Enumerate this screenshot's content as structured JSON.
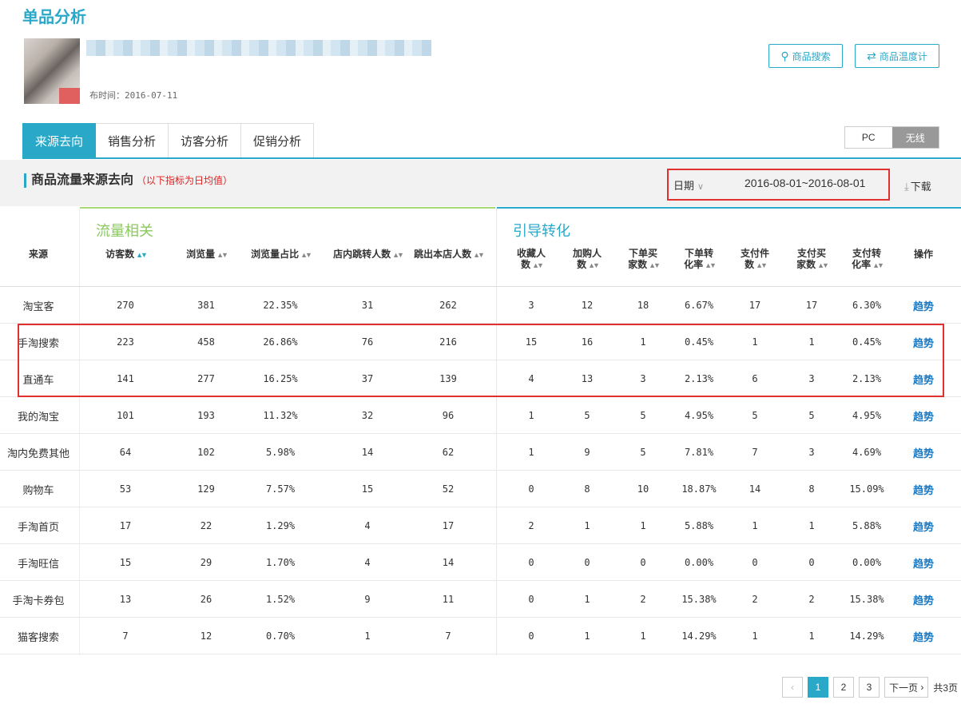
{
  "page": {
    "title": "单品分析"
  },
  "product": {
    "publish_time": "布时间：2016-07-11"
  },
  "buttons": {
    "search": "商品搜索",
    "compare": "商品温度计"
  },
  "tabs": [
    "来源去向",
    "销售分析",
    "访客分析",
    "促销分析"
  ],
  "device": {
    "pc": "PC",
    "wireless": "无线"
  },
  "section": {
    "title": "商品流量来源去向",
    "note": "（以下指标为日均值）"
  },
  "date": {
    "label": "日期",
    "range": "2016-08-01~2016-08-01"
  },
  "download": "下载",
  "groups": {
    "traffic": "流量相关",
    "conversion": "引导转化"
  },
  "columns": [
    {
      "label": "来源",
      "sortable": false
    },
    {
      "label": "访客数",
      "sortable": true,
      "active": true
    },
    {
      "label": "浏览量",
      "sortable": true
    },
    {
      "label": "浏览量占比",
      "sortable": true
    },
    {
      "label": "店内跳转人数",
      "sortable": true
    },
    {
      "label": "跳出本店人数",
      "sortable": true
    },
    {
      "label": "收藏人",
      "label2": "数",
      "sortable": true
    },
    {
      "label": "加购人",
      "label2": "数",
      "sortable": true
    },
    {
      "label": "下单买",
      "label2": "家数",
      "sortable": true
    },
    {
      "label": "下单转",
      "label2": "化率",
      "sortable": true
    },
    {
      "label": "支付件",
      "label2": "数",
      "sortable": true
    },
    {
      "label": "支付买",
      "label2": "家数",
      "sortable": true
    },
    {
      "label": "支付转",
      "label2": "化率",
      "sortable": true
    },
    {
      "label": "操作",
      "sortable": false
    }
  ],
  "rows": [
    [
      "淘宝客",
      "270",
      "381",
      "22.35%",
      "31",
      "262",
      "3",
      "12",
      "18",
      "6.67%",
      "17",
      "17",
      "6.30%",
      "趋势"
    ],
    [
      "手淘搜索",
      "223",
      "458",
      "26.86%",
      "76",
      "216",
      "15",
      "16",
      "1",
      "0.45%",
      "1",
      "1",
      "0.45%",
      "趋势"
    ],
    [
      "直通车",
      "141",
      "277",
      "16.25%",
      "37",
      "139",
      "4",
      "13",
      "3",
      "2.13%",
      "6",
      "3",
      "2.13%",
      "趋势"
    ],
    [
      "我的淘宝",
      "101",
      "193",
      "11.32%",
      "32",
      "96",
      "1",
      "5",
      "5",
      "4.95%",
      "5",
      "5",
      "4.95%",
      "趋势"
    ],
    [
      "淘内免费其他",
      "64",
      "102",
      "5.98%",
      "14",
      "62",
      "1",
      "9",
      "5",
      "7.81%",
      "7",
      "3",
      "4.69%",
      "趋势"
    ],
    [
      "购物车",
      "53",
      "129",
      "7.57%",
      "15",
      "52",
      "0",
      "8",
      "10",
      "18.87%",
      "14",
      "8",
      "15.09%",
      "趋势"
    ],
    [
      "手淘首页",
      "17",
      "22",
      "1.29%",
      "4",
      "17",
      "2",
      "1",
      "1",
      "5.88%",
      "1",
      "1",
      "5.88%",
      "趋势"
    ],
    [
      "手淘旺信",
      "15",
      "29",
      "1.70%",
      "4",
      "14",
      "0",
      "0",
      "0",
      "0.00%",
      "0",
      "0",
      "0.00%",
      "趋势"
    ],
    [
      "手淘卡券包",
      "13",
      "26",
      "1.52%",
      "9",
      "11",
      "0",
      "1",
      "2",
      "15.38%",
      "2",
      "2",
      "15.38%",
      "趋势"
    ],
    [
      "猫客搜索",
      "7",
      "12",
      "0.70%",
      "1",
      "7",
      "0",
      "1",
      "1",
      "14.29%",
      "1",
      "1",
      "14.29%",
      "趋势"
    ]
  ],
  "pager": {
    "prev": "‹",
    "pages": [
      "1",
      "2",
      "3"
    ],
    "next": "下一页",
    "total": "共3页"
  },
  "colors": {
    "accent": "#2aa8c8",
    "highlight": "#e03030",
    "traffic_group": "#8cc860",
    "link": "#1a78c2"
  }
}
